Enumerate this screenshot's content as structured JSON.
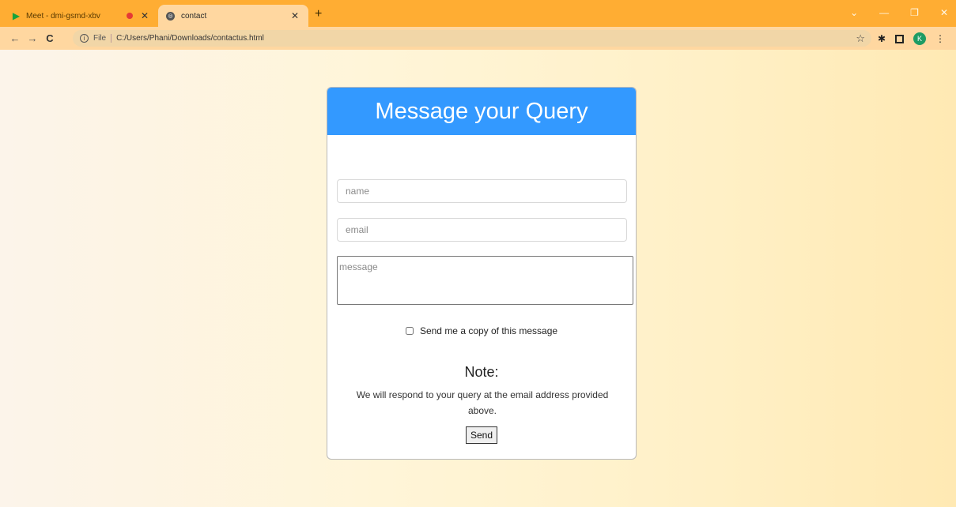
{
  "browser": {
    "tabs": [
      {
        "title": "Meet - dmi-gsmd-xbv",
        "icon": "google-meet-icon",
        "recording": true
      },
      {
        "title": "contact",
        "icon": "globe-icon",
        "active": true
      }
    ],
    "url_scheme_label": "File",
    "url": "C:/Users/Phani/Downloads/contactus.html",
    "profile_initial": "K",
    "accent_color": "#ffad33"
  },
  "form": {
    "title": "Message your Query",
    "name_placeholder": "name",
    "email_placeholder": "email",
    "message_placeholder": "message",
    "copy_label": "Send me a copy of this message",
    "copy_checked": false,
    "note_title": "Note:",
    "note_text": "We will respond to your query at the email address provided above.",
    "send_label": "Send",
    "header_color": "#3399ff"
  }
}
